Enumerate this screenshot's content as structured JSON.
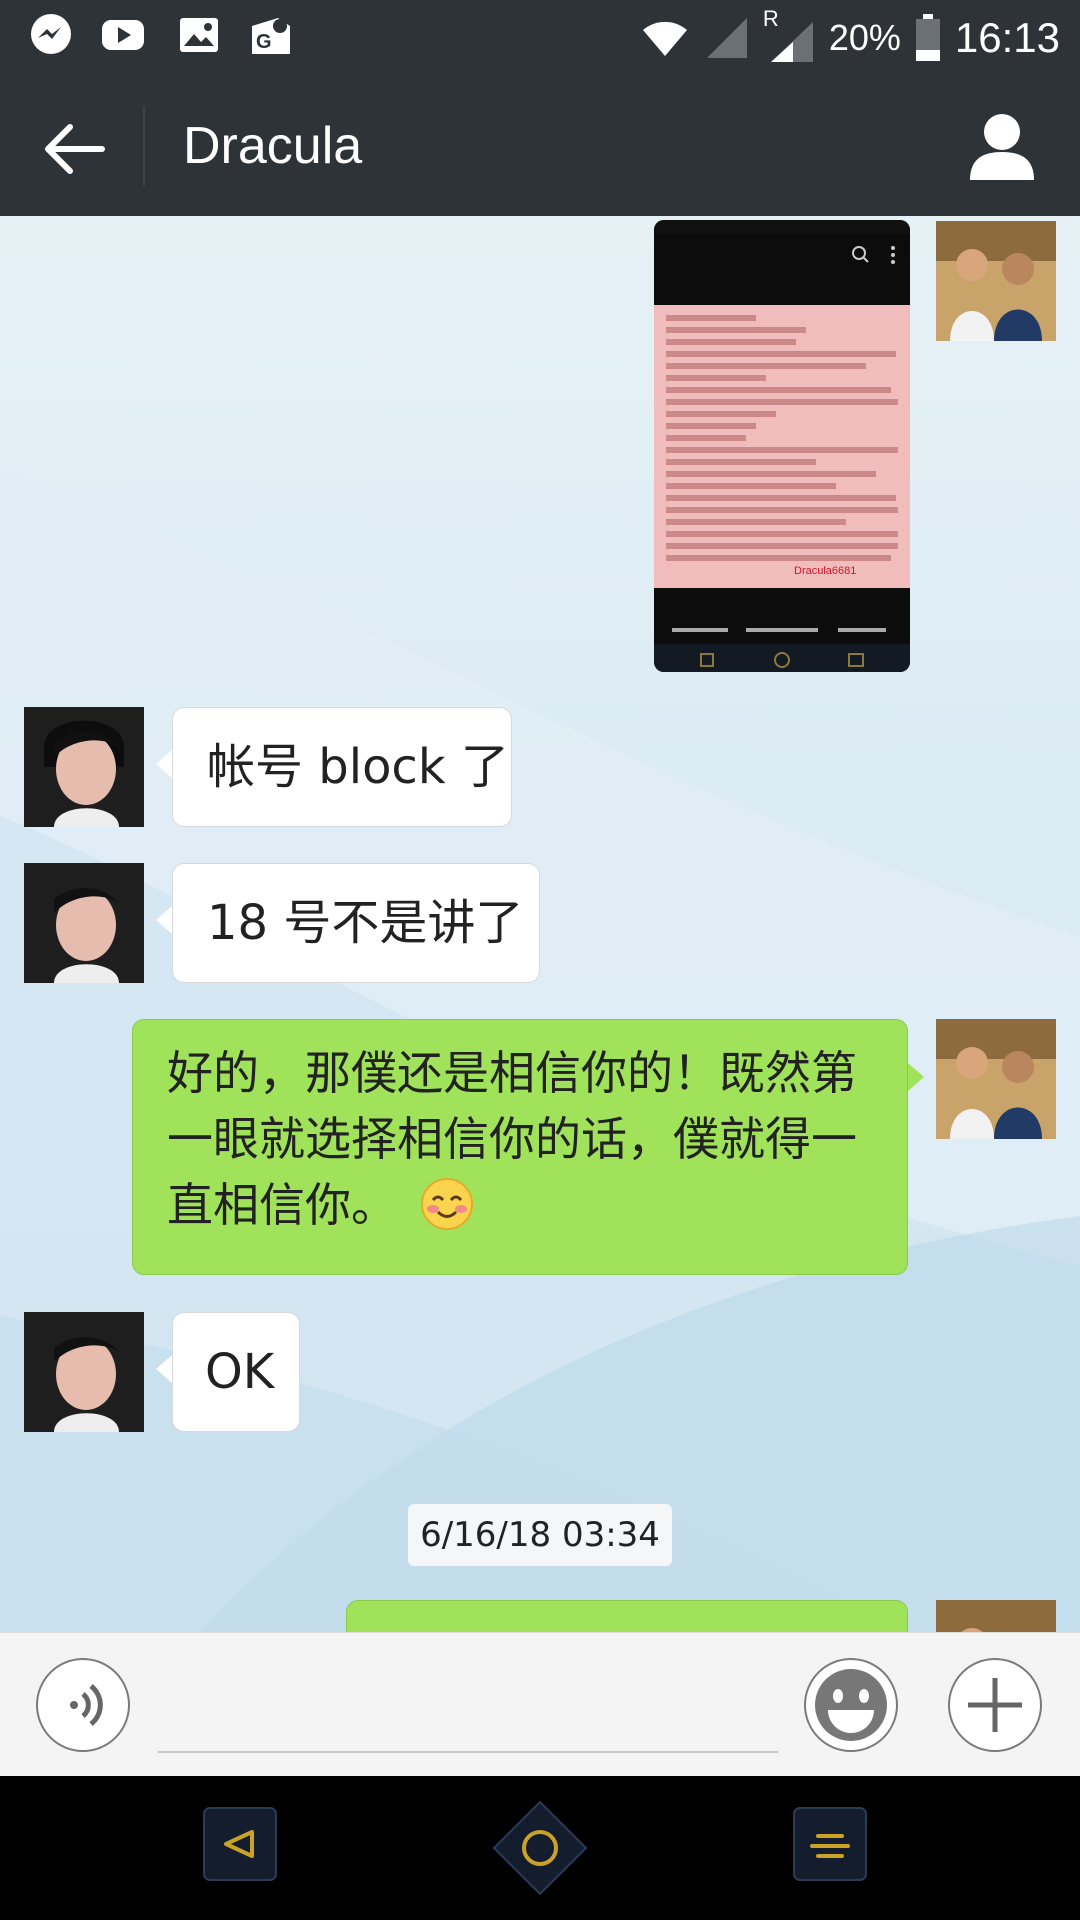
{
  "status_bar": {
    "battery": "20%",
    "time": "16:13",
    "roaming": "R",
    "icons": [
      "messenger-icon",
      "youtube-icon",
      "gallery-icon",
      "maps-icon",
      "wifi-icon",
      "signal-icon",
      "battery-icon"
    ]
  },
  "header": {
    "title": "Dracula"
  },
  "messages": [
    {
      "side": "out",
      "type": "image",
      "watermark": "Dracula6681"
    },
    {
      "side": "in",
      "type": "text",
      "text": "帐号 block 了"
    },
    {
      "side": "in",
      "type": "text",
      "text": "18 号不是讲了"
    },
    {
      "side": "out",
      "type": "text",
      "lines": [
        "好的，那僕还是相信你的！既然第",
        "一眼就选择相信你的话，僕就得一",
        "直相信你。"
      ],
      "emoji": "blush-emoji"
    },
    {
      "side": "in",
      "type": "text",
      "text": "OK"
    },
    {
      "type": "timestamp",
      "text": "6/16/18 03:34"
    }
  ],
  "colors": {
    "header_bg": "#2e3338",
    "outgoing_bubble": "#a0e35a",
    "incoming_bubble": "#ffffff",
    "nav_accent": "#c9a227"
  }
}
